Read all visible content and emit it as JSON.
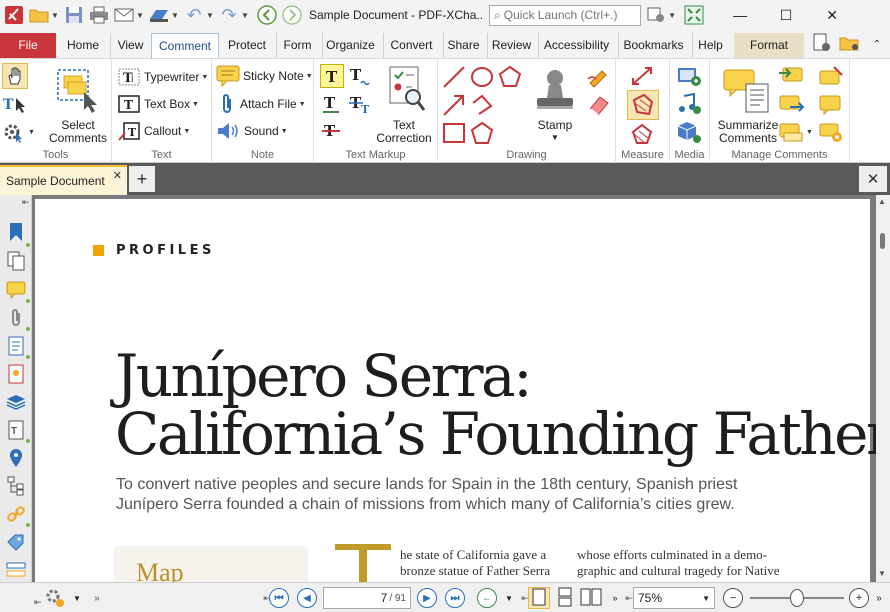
{
  "window": {
    "title": "Sample Document - PDF-XCha..",
    "quick_launch_placeholder": "Quick Launch (Ctrl+.)"
  },
  "ribbon_tabs": [
    {
      "label": "File"
    },
    {
      "label": "Home"
    },
    {
      "label": "View"
    },
    {
      "label": "Comment"
    },
    {
      "label": "Protect"
    },
    {
      "label": "Form"
    },
    {
      "label": "Organize"
    },
    {
      "label": "Convert"
    },
    {
      "label": "Share"
    },
    {
      "label": "Review"
    },
    {
      "label": "Accessibility"
    },
    {
      "label": "Bookmarks"
    },
    {
      "label": "Help"
    },
    {
      "label": "Format"
    }
  ],
  "ribbon": {
    "tools": {
      "label": "Tools",
      "select_comments": "Select Comments"
    },
    "text": {
      "label": "Text",
      "typewriter": "Typewriter",
      "text_box": "Text Box",
      "callout": "Callout"
    },
    "note": {
      "label": "Note",
      "sticky_note": "Sticky Note",
      "attach_file": "Attach File",
      "sound": "Sound"
    },
    "text_markup": {
      "label": "Text Markup",
      "text_correction": "Text Correction"
    },
    "drawing": {
      "label": "Drawing",
      "stamp": "Stamp"
    },
    "measure": {
      "label": "Measure"
    },
    "media": {
      "label": "Media"
    },
    "manage_comments": {
      "label": "Manage Comments",
      "summarize": "Summarize Comments"
    }
  },
  "document_tab": {
    "label": "Sample Document"
  },
  "page_content": {
    "section": "PROFILES",
    "headline_line1": "Junípero Serra:",
    "headline_line2": "California’s Founding Father",
    "dek_line1": "To convert native peoples and secure lands for Spain in the 18th century, Spanish priest",
    "dek_line2": "Junípero Serra founded a chain of missions from which many of California’s cities grew.",
    "map_label": "Map",
    "col1_line1": "he state of California gave a",
    "col1_line2": "bronze statue of Father Serra",
    "col2_line1": "whose efforts culminated in a demo-",
    "col2_line2": "graphic and cultural tragedy for Native"
  },
  "statusbar": {
    "current_page": "7",
    "total_pages": "/ 91",
    "zoom": "75%"
  },
  "zoom_level": 0.5,
  "colors": {
    "file_tab": "#c8353a",
    "accent_blue": "#2b6fb6",
    "format_tab": "#e8dfc6",
    "doc_tab_yellow": "#f1c232",
    "section_square": "#f0a500",
    "drop_cap": "#c09a2a"
  }
}
